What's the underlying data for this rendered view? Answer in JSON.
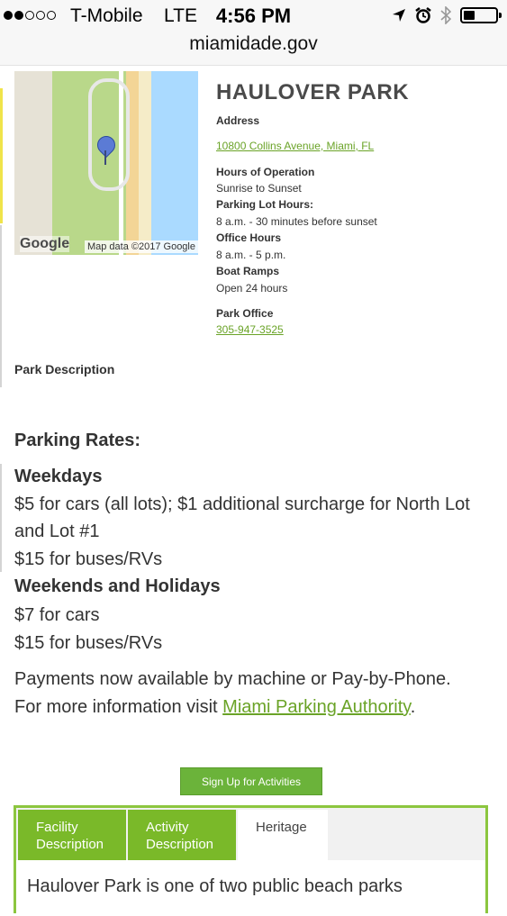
{
  "status_bar": {
    "carrier": "T-Mobile",
    "network": "LTE",
    "time": "4:56 PM",
    "signal_bars_filled": 2,
    "signal_bars_total": 5,
    "battery_level": 0.35,
    "icons": [
      "location-arrow-icon",
      "alarm-icon",
      "bluetooth-icon",
      "battery-icon"
    ]
  },
  "browser": {
    "url": "miamidade.gov"
  },
  "map": {
    "logo": "Google",
    "credit": "Map data ©2017 Google"
  },
  "park": {
    "title": "HAULOVER PARK",
    "address_label": "Address",
    "address": "10800 Collins Avenue, Miami, FL",
    "hours_label": "Hours of Operation",
    "hours": "Sunrise to Sunset",
    "parking_hours_label": "Parking Lot Hours:",
    "parking_hours": "8 a.m. - 30 minutes before sunset",
    "office_hours_label": "Office Hours",
    "office_hours": "8 a.m. - 5 p.m.",
    "boat_ramps_label": "Boat Ramps",
    "boat_ramps": "Open 24 hours",
    "park_office_label": "Park Office",
    "park_office_phone": "305-947-3525"
  },
  "description": {
    "label": "Park Description"
  },
  "parking_rates": {
    "heading": "Parking Rates:",
    "weekdays_heading": "Weekdays",
    "weekdays_line1": "$5 for cars (all lots); $1 additional surcharge for North Lot",
    "weekdays_line2": "and Lot #1",
    "weekdays_buses": "$15 for buses/RVs",
    "weekends_heading": "Weekends and Holidays",
    "weekends_cars": "$7 for cars",
    "weekends_buses": "$15 for buses/RVs",
    "payments_line1": "Payments now available by machine or Pay-by-Phone.",
    "payments_line2_prefix": "For more information visit ",
    "payments_link": "Miami Parking Authority",
    "payments_line2_suffix": "."
  },
  "cta": {
    "label": "Sign Up for Activities"
  },
  "tabs": [
    {
      "label_line1": "Facility",
      "label_line2": "Description"
    },
    {
      "label_line1": "Activity",
      "label_line2": "Description"
    },
    {
      "label_line1": "Heritage",
      "label_line2": ""
    }
  ],
  "tab_content": {
    "text": "Haulover Park is one of two public beach parks"
  },
  "colors": {
    "accent_green": "#7ab929",
    "link_green": "#6aa327",
    "border_green": "#8cc63f"
  }
}
